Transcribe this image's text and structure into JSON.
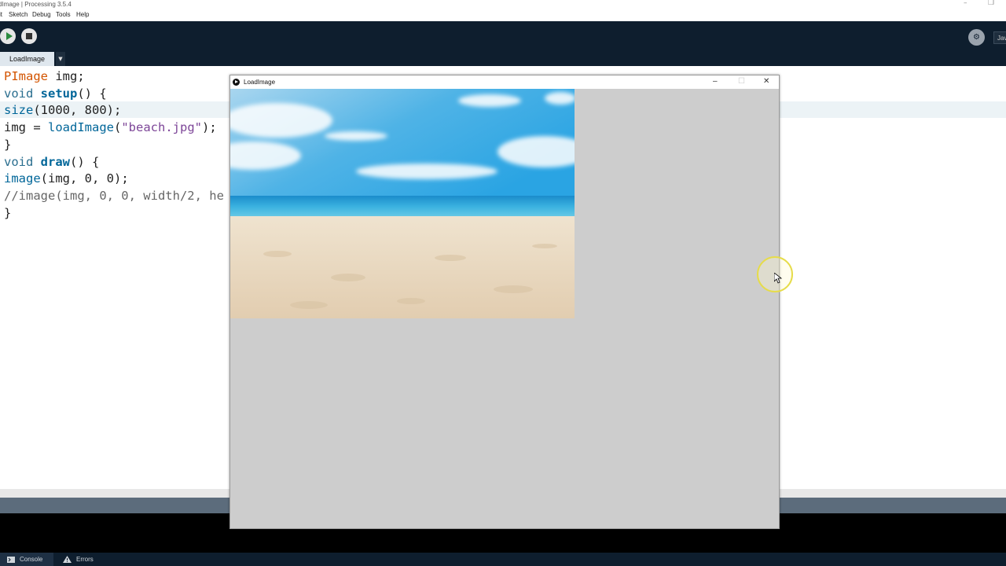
{
  "ide": {
    "title": "dImage | Processing 3.5.4",
    "menu": [
      "it",
      "Sketch",
      "Debug",
      "Tools",
      "Help"
    ],
    "mode_label": "Jav",
    "tab_label": "LoadImage",
    "tab_arrow": "▼"
  },
  "code_lines": [
    {
      "segments": [
        {
          "t": "PImage",
          "c": "type"
        },
        {
          "t": " img;",
          "c": "plain"
        }
      ]
    },
    {
      "segments": [
        {
          "t": "void",
          "c": "void"
        },
        {
          "t": " ",
          "c": "plain"
        },
        {
          "t": "setup",
          "c": "fn"
        },
        {
          "t": "() {",
          "c": "plain"
        }
      ]
    },
    {
      "segments": [
        {
          "t": "size",
          "c": "builtin"
        },
        {
          "t": "(1000, 800);",
          "c": "plain"
        }
      ]
    },
    {
      "segments": [
        {
          "t": "img = ",
          "c": "plain"
        },
        {
          "t": "loadImage",
          "c": "builtin"
        },
        {
          "t": "(",
          "c": "plain"
        },
        {
          "t": "\"beach.jpg\"",
          "c": "str"
        },
        {
          "t": ");",
          "c": "plain"
        }
      ]
    },
    {
      "segments": [
        {
          "t": "}",
          "c": "plain"
        }
      ]
    },
    {
      "segments": [
        {
          "t": "void",
          "c": "void"
        },
        {
          "t": " ",
          "c": "plain"
        },
        {
          "t": "draw",
          "c": "fn"
        },
        {
          "t": "() {",
          "c": "plain"
        }
      ]
    },
    {
      "segments": [
        {
          "t": "image",
          "c": "builtin"
        },
        {
          "t": "(img, 0, 0);",
          "c": "plain"
        }
      ]
    },
    {
      "segments": [
        {
          "t": "//image(img, 0, 0, width/2, he",
          "c": "comment"
        }
      ]
    },
    {
      "segments": [
        {
          "t": "}",
          "c": "plain"
        }
      ]
    }
  ],
  "sketch_window": {
    "title": "LoadImage",
    "background": "#cdcdcd"
  },
  "footer": {
    "console_label": "Console",
    "errors_label": "Errors"
  },
  "colors": {
    "toolbar": "#0e1e2e",
    "keyword_type": "#d35400",
    "keyword_fn": "#006699",
    "string": "#7d4698"
  }
}
